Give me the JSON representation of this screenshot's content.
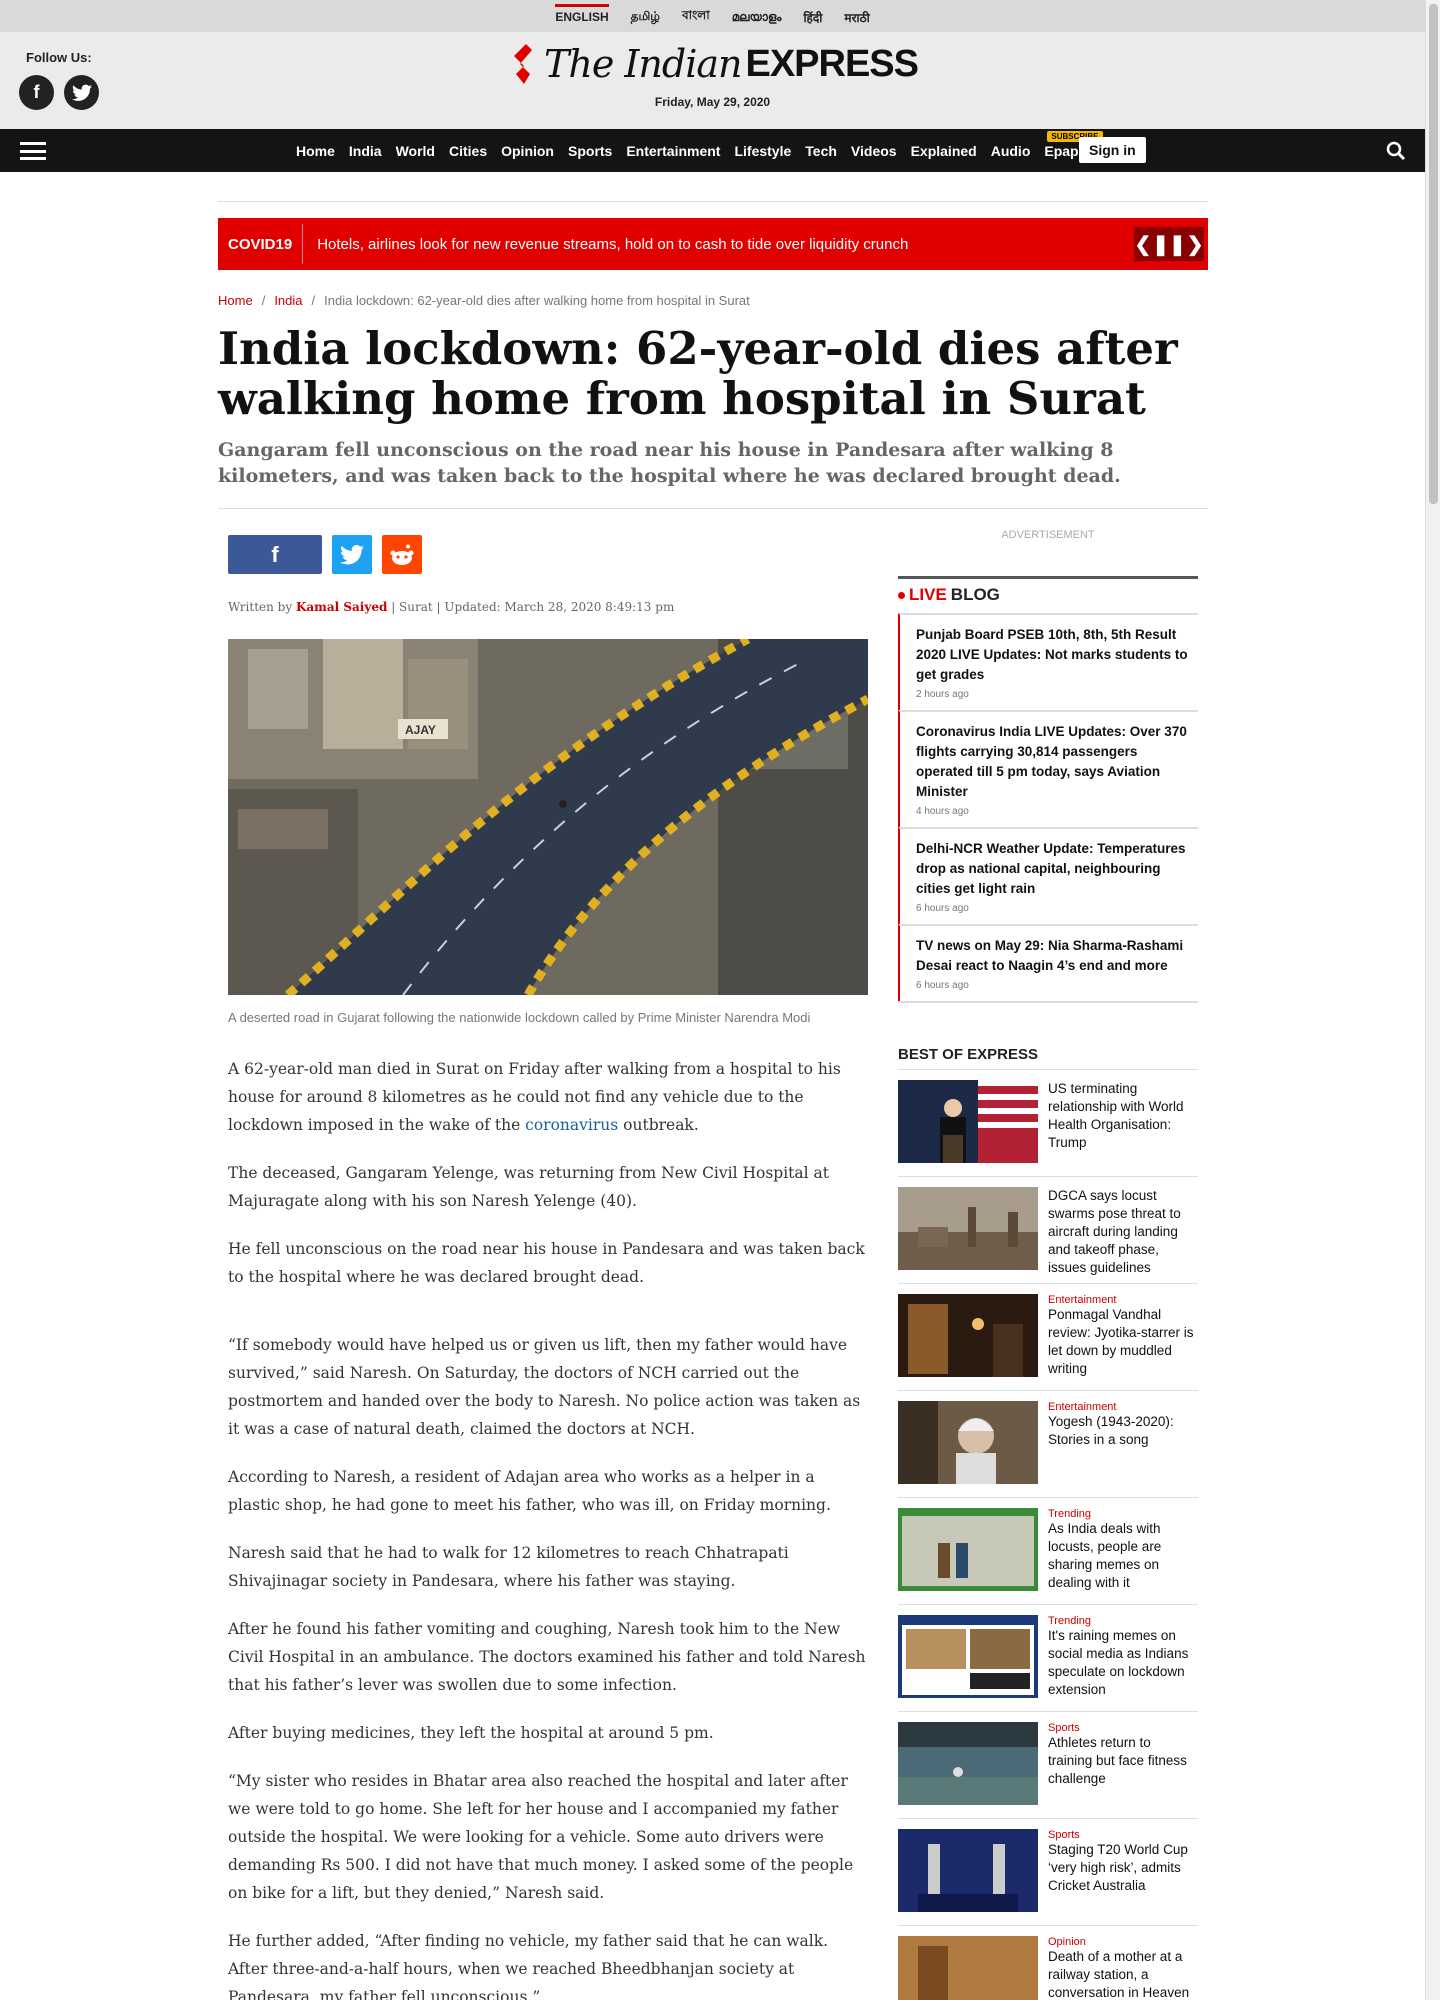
{
  "languages": [
    "ENGLISH",
    "தமிழ்",
    "বাংলা",
    "മലയാളം",
    "हिंदी",
    "मराठी"
  ],
  "header": {
    "follow_label": "Follow Us:",
    "logo_italic": "The Indian",
    "logo_bold": "EXPRESS",
    "date": "Friday, May 29, 2020"
  },
  "nav": {
    "links": [
      "Home",
      "India",
      "World",
      "Cities",
      "Opinion",
      "Sports",
      "Entertainment",
      "Lifestyle",
      "Tech",
      "Videos",
      "Explained",
      "Audio"
    ],
    "epaper": "Epaper",
    "subscribe": "SUBSCRIBE",
    "signin": "Sign in"
  },
  "ticker": {
    "label": "COVID19",
    "text": "Hotels, airlines look for new revenue streams, hold on to cash to tide over liquidity crunch"
  },
  "breadcrumb": {
    "home": "Home",
    "section": "India",
    "current": "India lockdown: 62-year-old dies after walking home from hospital in Surat"
  },
  "article": {
    "headline": "India lockdown: 62-year-old dies after walking home from hospital in Surat",
    "subhead": "Gangaram fell unconscious on the road near his house in Pandesara after walking 8 kilometers, and was taken back to the hospital where he was declared brought dead.",
    "byline_prefix": "Written by",
    "author": "Kamal Saiyed",
    "byline_rest": "| Surat | Updated: March 28, 2020 8:49:13 pm",
    "caption": "A deserted road in Gujarat following the nationwide lockdown called by Prime Minister Narendra Modi",
    "photo_sign": "AJAY",
    "p1_a": "A 62-year-old man died in Surat on Friday after walking from a hospital to his house for around 8 kilometres as he could not find any vehicle due to the lockdown imposed in the wake of the ",
    "p1_link": "coronavirus",
    "p1_b": " outbreak.",
    "p2": "The deceased, Gangaram Yelenge, was returning from New Civil Hospital at Majuragate along with his son Naresh Yelenge (40).",
    "p3": "He fell unconscious on the road near his house in Pandesara and was taken back to the hospital where he was declared brought dead.",
    "p4": "“If somebody would have helped us or given us lift, then my father would have survived,” said Naresh. On Saturday, the doctors of NCH carried out the postmortem and handed over the body to Naresh. No police action was taken as it was a case of natural death, claimed the doctors at NCH.",
    "p5": "According to Naresh, a resident of Adajan area who works as a helper in a plastic shop, he had gone to meet his father, who was ill, on Friday morning.",
    "p6": "Naresh said that he had to walk for 12 kilometres to reach Chhatrapati Shivajinagar society in Pandesara, where his father was staying.",
    "p7": "After he found his father vomiting and coughing, Naresh took him to the New Civil Hospital in an ambulance. The doctors examined his father and told Naresh that his father’s lever was swollen due to some infection.",
    "p8": "After buying medicines, they left the hospital at around 5 pm.",
    "p9": "“My sister who resides in Bhatar area also reached the hospital and later after we were told to go home. She left for her house and I accompanied my father outside the hospital. We were looking for a vehicle. Some auto drivers were demanding Rs 500. I did not have that much money. I asked some of the people on bike for a lift, but they denied,” Naresh said.",
    "p10": "He further added, “After finding no vehicle, my father said that he can walk. After three-and-a-half hours, when we reached Bheedbhanjan society at Pandesara, my father fell unconscious.”"
  },
  "sidebar": {
    "ad_label": "ADVERTISEMENT",
    "live_red": "LIVE",
    "live_black": "BLOG",
    "live_items": [
      {
        "title": "Punjab Board PSEB 10th, 8th, 5th Result 2020 LIVE Updates: Not marks students to get grades",
        "time": "2 hours ago"
      },
      {
        "title": "Coronavirus India LIVE Updates: Over 370 flights carrying 30,814 passengers operated till 5 pm today, says Aviation Minister",
        "time": "4 hours ago"
      },
      {
        "title": "Delhi-NCR Weather Update: Temperatures drop as national capital, neighbouring cities get light rain",
        "time": "6 hours ago"
      },
      {
        "title": "TV news on May 29: Nia Sharma-Rashami Desai react to Naagin 4’s end and more",
        "time": "6 hours ago"
      }
    ],
    "best_heading": "BEST OF EXPRESS",
    "best_items": [
      {
        "category": "",
        "title": "US terminating relationship with World Health Organisation: Trump"
      },
      {
        "category": "",
        "title": "DGCA says locust swarms pose threat to aircraft during landing and takeoff phase, issues guidelines"
      },
      {
        "category": "Entertainment",
        "title": "Ponmagal Vandhal review: Jyotika-starrer is let down by muddled writing"
      },
      {
        "category": "Entertainment",
        "title": "Yogesh (1943-2020): Stories in a song"
      },
      {
        "category": "Trending",
        "title": "As India deals with locusts, people are sharing memes on dealing with it"
      },
      {
        "category": "Trending",
        "title": "It's raining memes on social media as Indians speculate on lockdown extension"
      },
      {
        "category": "Sports",
        "title": "Athletes return to training but face fitness challenge"
      },
      {
        "category": "Sports",
        "title": "Staging T20 World Cup ‘very high risk’, admits Cricket Australia"
      },
      {
        "category": "Opinion",
        "title": "Death of a mother at a railway station, a conversation in Heaven"
      }
    ]
  },
  "colors": {
    "brand_red": "#e00000",
    "nav_bg": "#141414"
  }
}
